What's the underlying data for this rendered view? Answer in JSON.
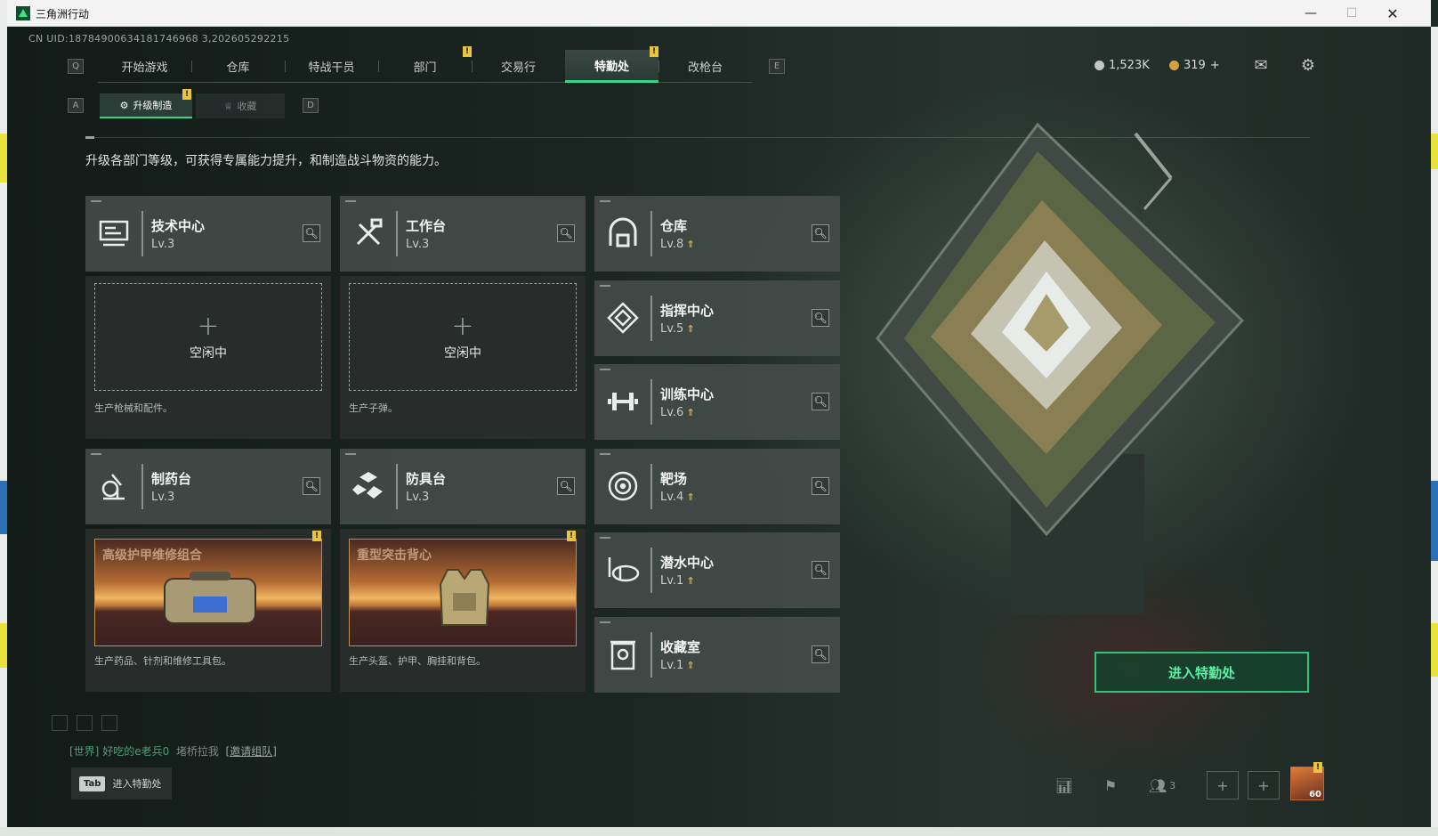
{
  "window": {
    "title": "三角洲行动",
    "minimize": "—",
    "maximize": "☐",
    "close": "✕"
  },
  "uid": "CN UID:18784900634181746968 3,202605292215",
  "nav": {
    "left_key": "Q",
    "right_key": "E",
    "tabs": [
      "开始游戏",
      "仓库",
      "特战干员",
      "部门",
      "交易行",
      "特勤处",
      "改枪台"
    ],
    "active": "特勤处",
    "alert_mark": "!"
  },
  "currency": {
    "silver": "1,523K",
    "gold": "319",
    "add": "+"
  },
  "subtabs": {
    "left_key": "A",
    "right_key": "D",
    "active": "升级制造",
    "inactive": "收藏"
  },
  "description": "升级各部门等级，可获得专属能力提升，和制造战斗物资的能力。",
  "cards": {
    "tech": {
      "name": "技术中心",
      "level": "Lv.3",
      "icon": "monitor-icon"
    },
    "workbench": {
      "name": "工作台",
      "level": "Lv.3",
      "icon": "tools-icon"
    },
    "pharmacy": {
      "name": "制药台",
      "level": "Lv.3",
      "icon": "microscope-icon"
    },
    "armor": {
      "name": "防具台",
      "level": "Lv.3",
      "icon": "armor-parts-icon"
    },
    "warehouse": {
      "name": "仓库",
      "level": "Lv.8",
      "icon": "warehouse-icon"
    },
    "command": {
      "name": "指挥中心",
      "level": "Lv.5",
      "icon": "command-icon"
    },
    "training": {
      "name": "训练中心",
      "level": "Lv.6",
      "icon": "dumbbell-icon"
    },
    "range": {
      "name": "靶场",
      "level": "Lv.4",
      "icon": "target-icon"
    },
    "diving": {
      "name": "潜水中心",
      "level": "Lv.1",
      "icon": "diving-mask-icon"
    },
    "collection": {
      "name": "收藏室",
      "level": "Lv.1",
      "icon": "collection-icon"
    }
  },
  "slots": {
    "tech": {
      "plus": "+",
      "status": "空闲中",
      "note": "生产枪械和配件。"
    },
    "workbench": {
      "plus": "+",
      "status": "空闲中",
      "note": "生产子弹。"
    }
  },
  "promos": {
    "pharmacy": {
      "title": "高级护甲维修组合",
      "note": "生产药品、针剂和维修工具包。"
    },
    "armor": {
      "title": "重型突击背心",
      "note": "生产头盔、护甲、胸挂和背包。"
    }
  },
  "enter_button": "进入特勤处",
  "chat": {
    "channel": "[世界]",
    "user": "好吃的e老兵0",
    "message": "堵桥拉我",
    "invite": "[邀请组队]"
  },
  "tab_hint": {
    "key": "Tab",
    "label": "进入特勤处"
  },
  "friends_count": "3",
  "player_level": "60",
  "colors": {
    "accent": "#37d58a",
    "alert": "#e8c440",
    "upgrade_arrow": "#e2b24a"
  }
}
